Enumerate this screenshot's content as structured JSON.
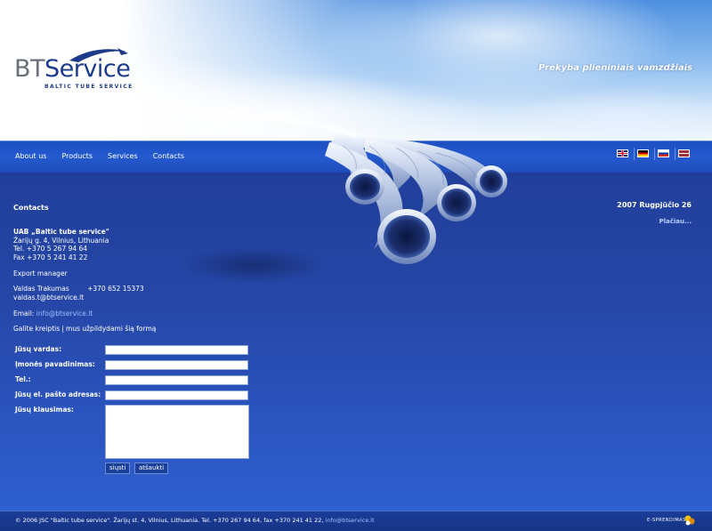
{
  "header": {
    "logo_bt": "BT",
    "logo_service": "Service",
    "logo_sub": "BALTIC TUBE SERVICE",
    "tagline": "Prekyba plieniniais vamzdžiais"
  },
  "nav": {
    "items": [
      "About us",
      "Products",
      "Services",
      "Contacts"
    ]
  },
  "languages": [
    {
      "icon": "uk-flag-icon"
    },
    {
      "icon": "germany-flag-icon"
    },
    {
      "icon": "russia-flag-icon"
    },
    {
      "icon": "latvia-flag-icon"
    }
  ],
  "contacts": {
    "title": "Contacts",
    "company": "UAB „Baltic tube service\"",
    "address": "Žarijų g. 4, Vilnius, Lithuania",
    "tel": "Tel. +370 5 267 94 64",
    "fax": "Fax +370 5 241 41 22",
    "export_label": "Export manager",
    "person_name": "Valdas Trakumas",
    "person_phone": "+370 652 15373",
    "person_email": "valdas.t@btservice.lt",
    "email_label": "Email:",
    "email": "info@btservice.lt",
    "form_intro": "Galite kreiptis į mus užpildydami šią formą"
  },
  "form": {
    "name_label": "Jūsų vardas:",
    "company_label": "Įmonės pavadinimas:",
    "tel_label": "Tel.:",
    "email_label": "Jūsų el. pašto adresas:",
    "question_label": "Jūsų klausimas:",
    "submit": "siųsti",
    "cancel": "atšaukti"
  },
  "news": {
    "date": "2007 Rugpjūčio 26",
    "more": "Plačiau..."
  },
  "footer": {
    "text": "© 2006 JSC \"Baltic tube service\". Žarijų st. 4, Vilnius, Lithuania. Tel. +370 267 94 64, fax +370 241 41 22,",
    "email": "info@btservice.lt",
    "brand": "E-SPRENDIMAS"
  },
  "colors": {
    "brand_blue": "#1b3a8a",
    "band_blue": "#245ad0",
    "content_blue": "#2647a8",
    "link": "#9fc0ff"
  }
}
